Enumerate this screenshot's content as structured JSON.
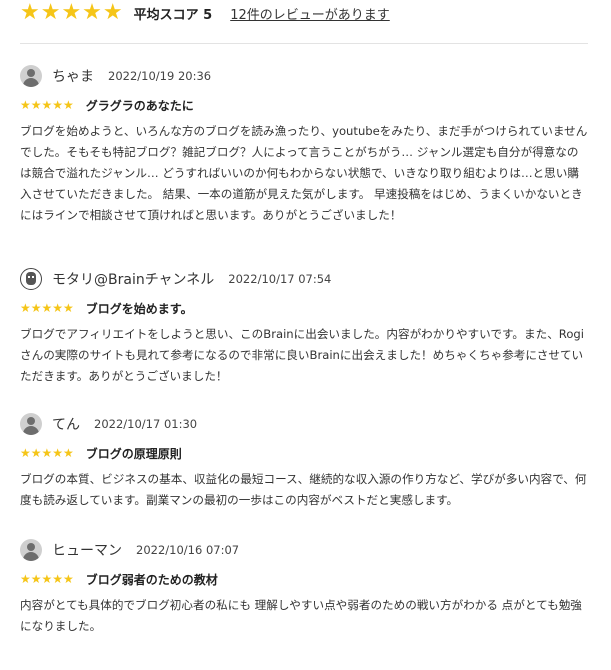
{
  "summary": {
    "stars": "★★★★★",
    "average_label": "平均スコア 5",
    "review_count_link": "12件のレビューがあります"
  },
  "colors": {
    "star": "#f5c518",
    "text": "#333333"
  },
  "reviews": [
    {
      "avatar_icon": "default-user-icon",
      "name": "ちゃま",
      "date": "2022/10/19 20:36",
      "stars": "★★★★★",
      "title": "グラグラのあなたに",
      "body": "ブログを始めようと、いろんな方のブログを読み漁ったり、youtubeをみたり、まだ手がつけられていませんでした。そもそも特記ブログ？雑記ブログ？人によって言うことがちがう… ジャンル選定も自分が得意なのは競合で溢れたジャンル… どうすればいいのか何もわからない状態で、いきなり取り組むよりは…と思い購入させていただきました。 結果、一本の道筋が見えた気がします。 早速投稿をはじめ、うまくいかないときにはラインで相談させて頂ければと思います。ありがとうございました！"
    },
    {
      "avatar_icon": "custom-avatar-icon",
      "name": "モタリ@Brainチャンネル",
      "date": "2022/10/17 07:54",
      "stars": "★★★★★",
      "title": "ブログを始めます。",
      "body": "ブログでアフィリエイトをしようと思い、このBrainに出会いました。内容がわかりやすいです。また、Rogiさんの実際のサイトも見れて参考になるので非常に良いBrainに出会えました！めちゃくちゃ参考にさせていただきます。ありがとうございました！"
    },
    {
      "avatar_icon": "default-user-icon",
      "name": "てん",
      "date": "2022/10/17 01:30",
      "stars": "★★★★★",
      "title": "ブログの原理原則",
      "body": "ブログの本質、ビジネスの基本、収益化の最短コース、継続的な収入源の作り方など、学びが多い内容で、何度も読み返しています。副業マンの最初の一歩はこの内容がベストだと実感します。"
    },
    {
      "avatar_icon": "default-user-icon",
      "name": "ヒューマン",
      "date": "2022/10/16 07:07",
      "stars": "★★★★★",
      "title": "ブログ弱者のための教材",
      "body": "内容がとても具体的でブログ初心者の私にも 理解しやすい点や弱者のための戦い方がわかる 点がとても勉強になりました。"
    }
  ]
}
